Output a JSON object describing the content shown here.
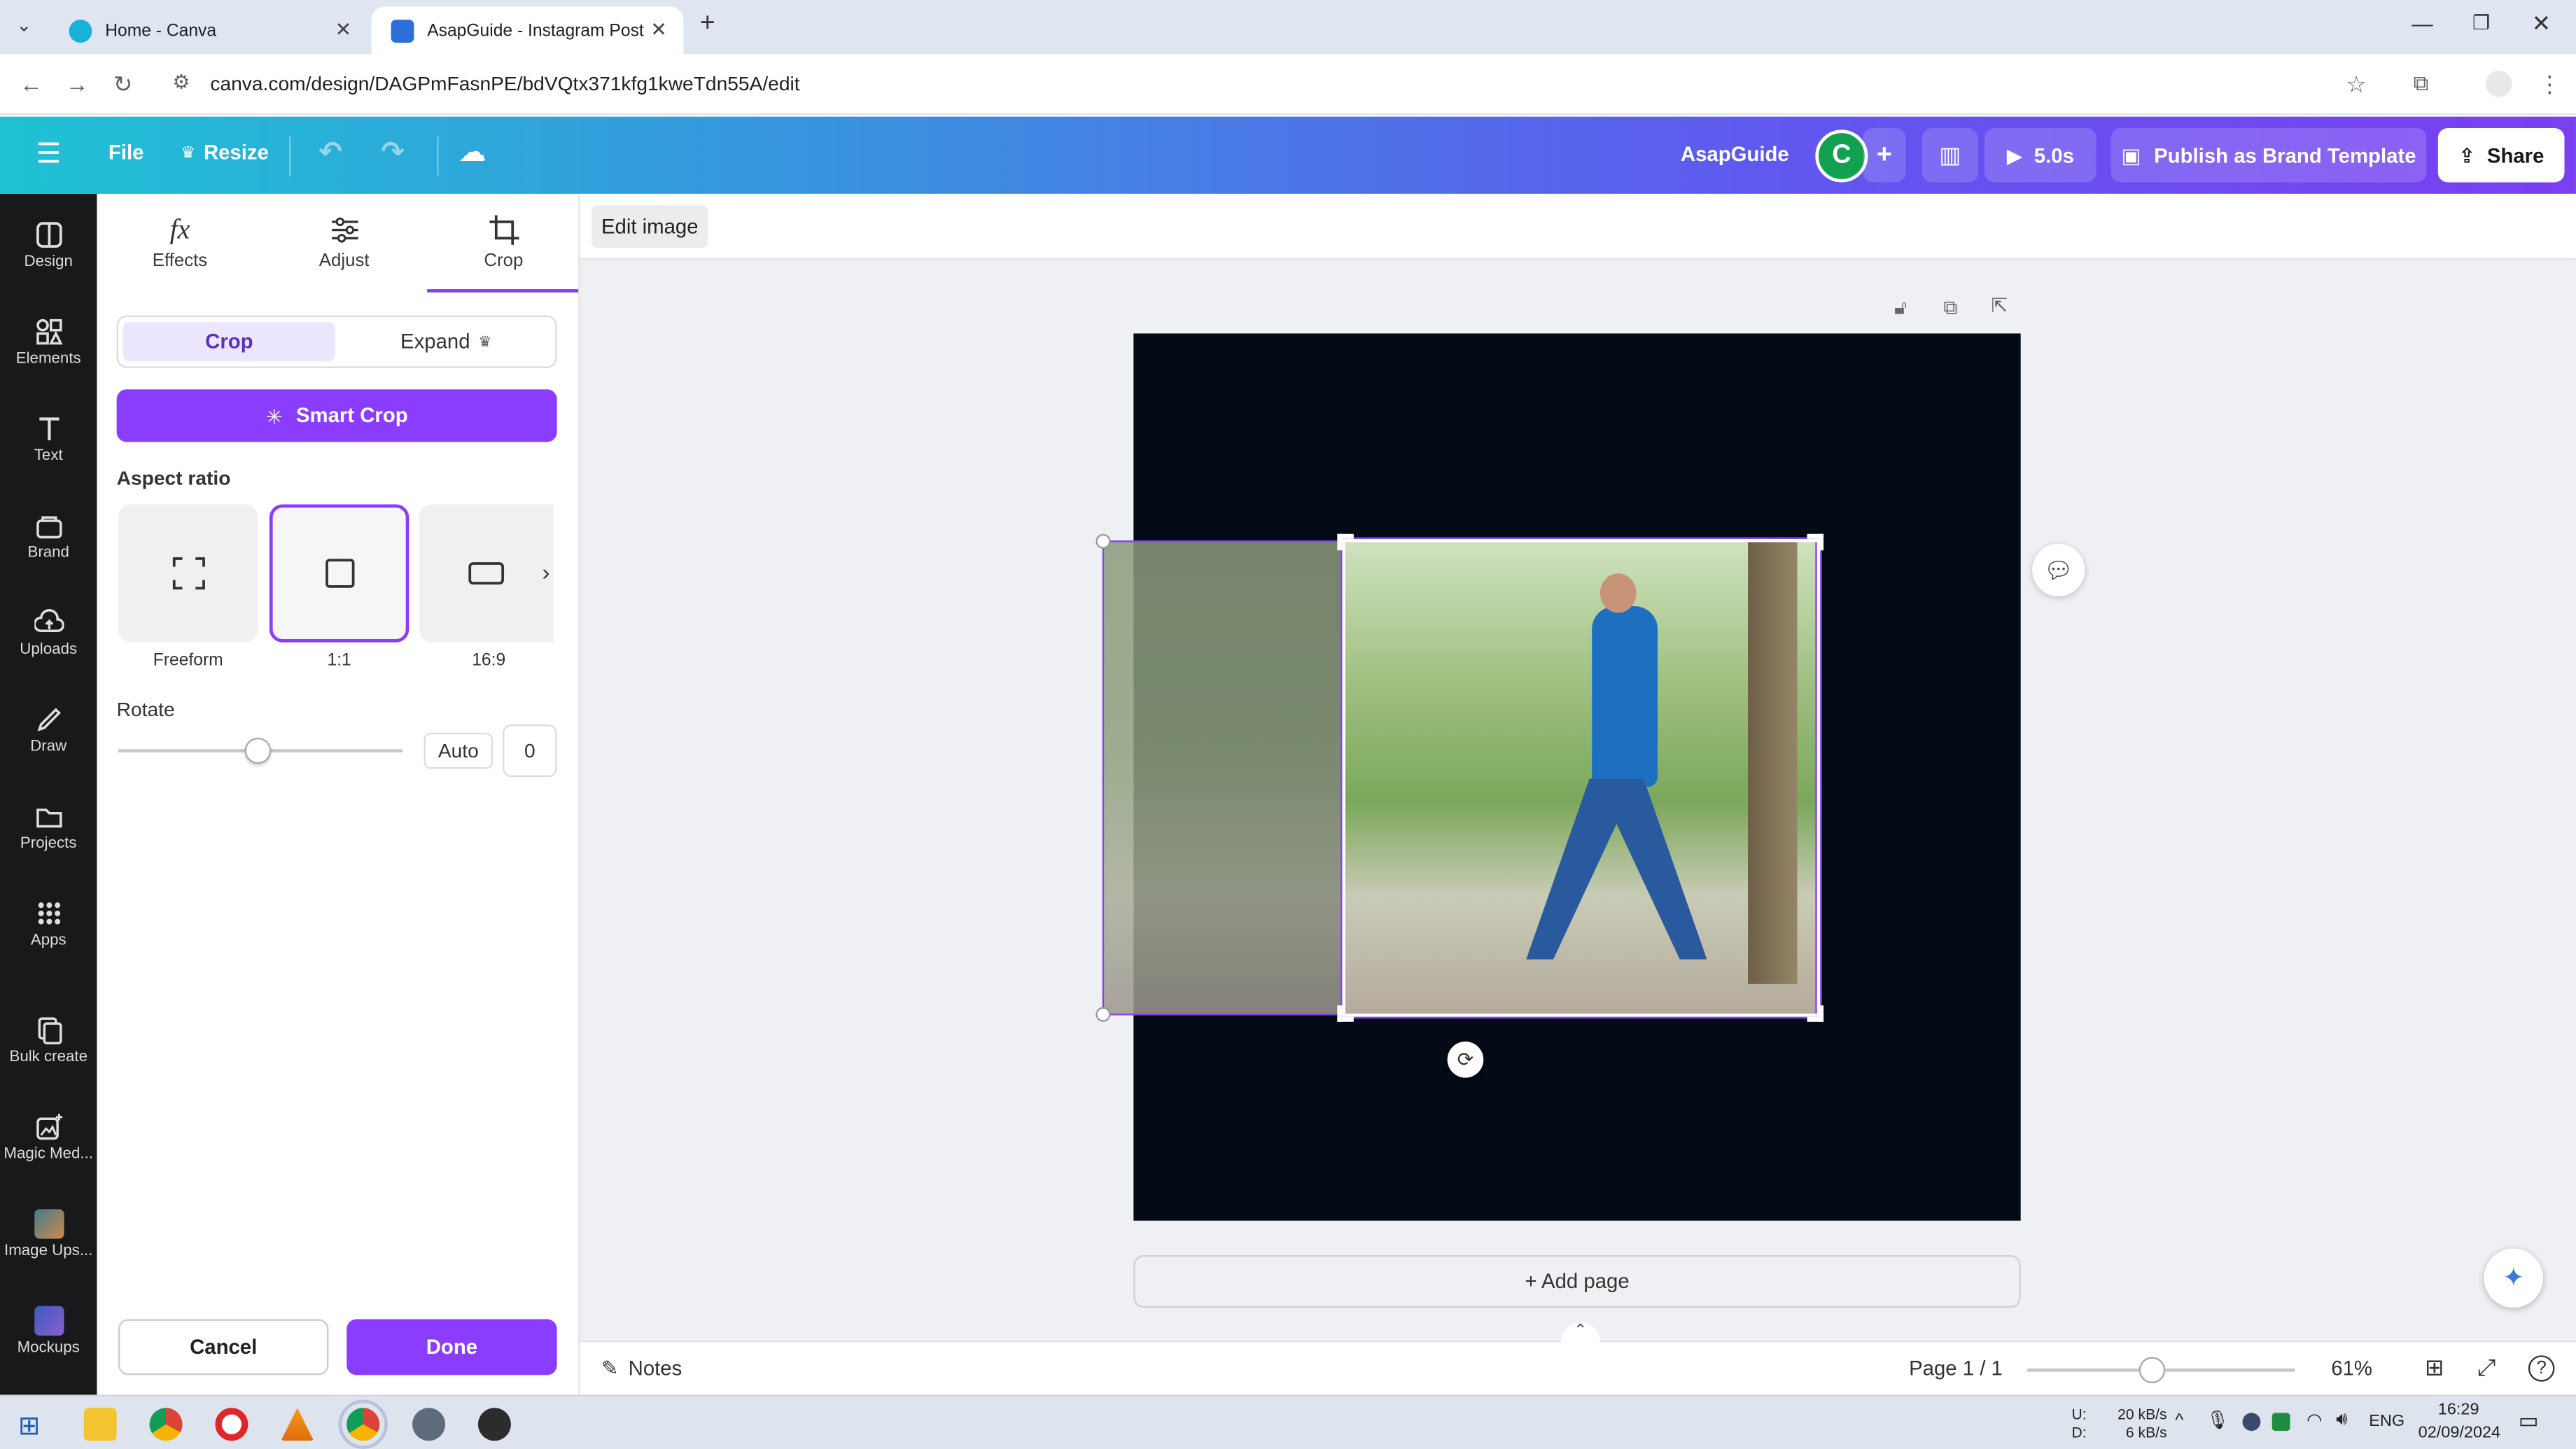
{
  "browser": {
    "tabs": [
      {
        "label": "Home - Canva"
      },
      {
        "label": "AsapGuide - Instagram Post"
      }
    ],
    "url": "canva.com/design/DAGPmFasnPE/bdVQtx371kfg1kweTdn55A/edit"
  },
  "topbar": {
    "file": "File",
    "resize": "Resize",
    "brand_name": "AsapGuide",
    "avatar_letter": "C",
    "duration": "5.0s",
    "publish": "Publish as Brand Template",
    "share": "Share"
  },
  "rail": [
    {
      "label": "Design",
      "icon": "design-icon"
    },
    {
      "label": "Elements",
      "icon": "elements-icon"
    },
    {
      "label": "Text",
      "icon": "text-icon"
    },
    {
      "label": "Brand",
      "icon": "brand-icon"
    },
    {
      "label": "Uploads",
      "icon": "uploads-icon"
    },
    {
      "label": "Draw",
      "icon": "draw-icon"
    },
    {
      "label": "Projects",
      "icon": "projects-icon"
    },
    {
      "label": "Apps",
      "icon": "apps-icon"
    },
    {
      "label": "Bulk create",
      "icon": "bulk-create-icon"
    },
    {
      "label": "Magic Med...",
      "icon": "magic-media-icon"
    },
    {
      "label": "Image Ups...",
      "icon": "image-upscaler-icon"
    },
    {
      "label": "Mockups",
      "icon": "mockups-icon"
    }
  ],
  "panel": {
    "tabs": [
      {
        "label": "Effects",
        "glyph": "fx"
      },
      {
        "label": "Adjust",
        "glyph": ""
      },
      {
        "label": "Crop",
        "glyph": ""
      }
    ],
    "segments": {
      "crop": "Crop",
      "expand": "Expand"
    },
    "smart_crop": "Smart Crop",
    "aspect_ratio_title": "Aspect ratio",
    "aspect_ratios": [
      {
        "label": "Freeform"
      },
      {
        "label": "1:1"
      },
      {
        "label": "16:9"
      }
    ],
    "rotate_title": "Rotate",
    "rotate_auto": "Auto",
    "rotate_value": "0",
    "cancel": "Cancel",
    "done": "Done"
  },
  "workspace": {
    "edit_image": "Edit image",
    "add_page": "+ Add page",
    "notes": "Notes",
    "page_indicator": "Page 1 / 1",
    "zoom": "61%"
  },
  "taskbar": {
    "net_up_label": "U:",
    "net_down_label": "D:",
    "net_up": "20 kB/s",
    "net_down": "6 kB/s",
    "lang": "ENG",
    "time": "16:29",
    "date": "02/09/2024"
  },
  "colors": {
    "accent_purple": "#8b3dff",
    "canvas_bg": "#040b16",
    "rail_bg": "#18191b"
  }
}
